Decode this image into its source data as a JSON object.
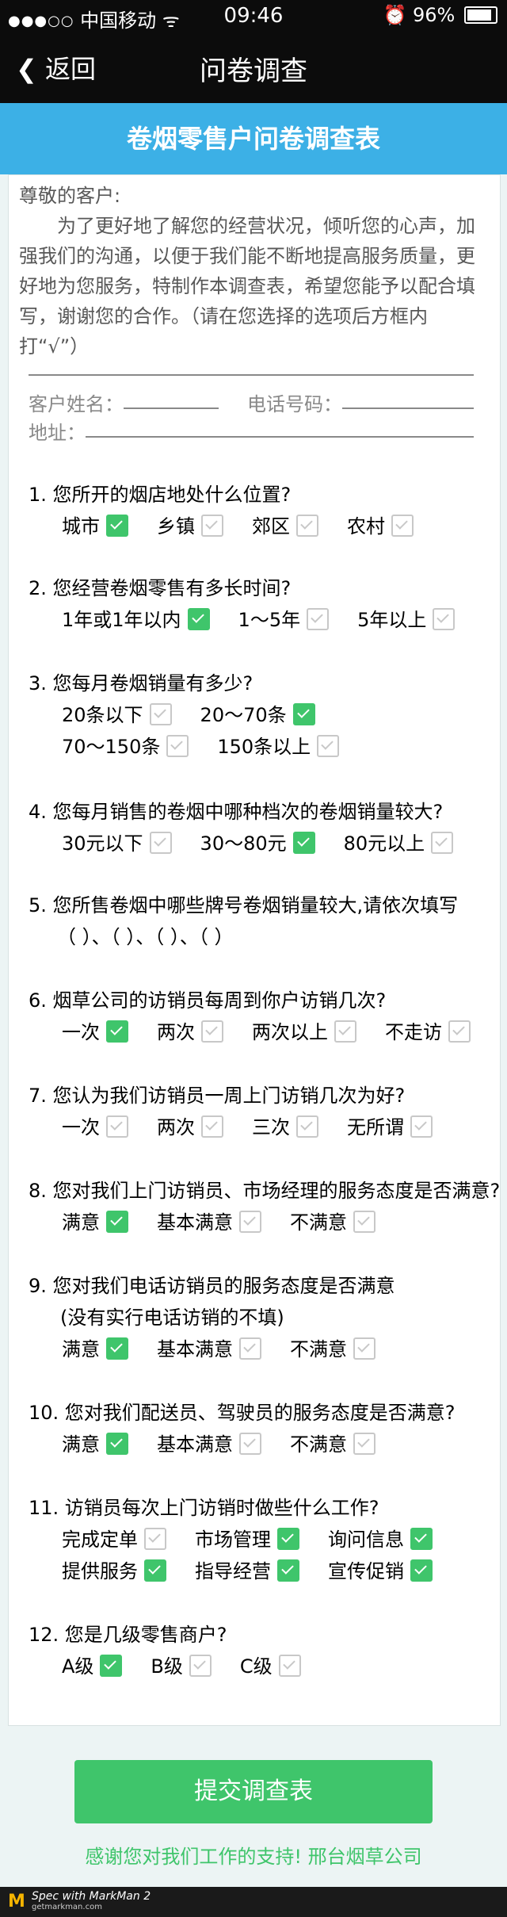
{
  "status": {
    "signal": "●●●○○",
    "carrier": "中国移动",
    "wifi": "ᯤ",
    "time": "09:46",
    "alarm": "⏰",
    "battery": "96%"
  },
  "nav": {
    "back": "返回",
    "title": "问卷调查"
  },
  "banner": {
    "title": "卷烟零售户问卷调查表"
  },
  "intro": {
    "greeting": "尊敬的客户:",
    "body": "为了更好地了解您的经营状况，倾听您的心声，加强我们的沟通，以便于我们能不断地提高服务质量，更好地为您服务，特制作本调查表，希望您能予以配合填写，谢谢您的合作。（请在您选择的选项后方框内打“√”）"
  },
  "fields": {
    "name_label": "客户姓名：",
    "phone_label": "电话号码：",
    "address_label": "地址："
  },
  "questions": [
    {
      "title": "1.  您所开的烟店地处什么位置?",
      "options": [
        [
          "城市",
          true
        ],
        [
          "乡镇",
          false
        ],
        [
          "郊区",
          false
        ],
        [
          "农村",
          false
        ]
      ]
    },
    {
      "title": "2.  您经营卷烟零售有多长时间?",
      "options": [
        [
          "1年或1年以内",
          true
        ],
        [
          "1～5年",
          false
        ],
        [
          "5年以上",
          false
        ]
      ]
    },
    {
      "title": "3.  您每月卷烟销量有多少?",
      "options": [
        [
          "20条以下",
          false
        ],
        [
          "20～70条",
          true
        ]
      ],
      "options2": [
        [
          "70～150条",
          false
        ],
        [
          "150条以上",
          false
        ]
      ]
    },
    {
      "title": "4.  您每月销售的卷烟中哪种档次的卷烟销量较大?",
      "options": [
        [
          "30元以下",
          false
        ],
        [
          "30～80元",
          true
        ],
        [
          "80元以上",
          false
        ]
      ]
    },
    {
      "title": "5.  您所售卷烟中哪些牌号卷烟销量较大,请依次填写",
      "blanks": "（          ）、（          ）、（          ）、（          ）"
    },
    {
      "title": "6.  烟草公司的访销员每周到你户访销几次?",
      "options": [
        [
          "一次",
          true
        ],
        [
          "两次",
          false
        ],
        [
          "两次以上",
          false
        ],
        [
          "不走访",
          false
        ]
      ]
    },
    {
      "title": "7.  您认为我们访销员一周上门访销几次为好?",
      "options": [
        [
          "一次",
          false
        ],
        [
          "两次",
          false
        ],
        [
          "三次",
          false
        ],
        [
          "无所谓",
          false
        ]
      ]
    },
    {
      "title": "8.  您对我们上门访销员、市场经理的服务态度是否满意?",
      "options": [
        [
          "满意",
          true
        ],
        [
          "基本满意",
          false
        ],
        [
          "不满意",
          false
        ]
      ]
    },
    {
      "title": "9.  您对我们电话访销员的服务态度是否满意",
      "subtitle": "(没有实行电话访销的不填)",
      "options": [
        [
          "满意",
          true
        ],
        [
          "基本满意",
          false
        ],
        [
          "不满意",
          false
        ]
      ]
    },
    {
      "title": "10. 您对我们配送员、驾驶员的服务态度是否满意?",
      "options": [
        [
          "满意",
          true
        ],
        [
          "基本满意",
          false
        ],
        [
          "不满意",
          false
        ]
      ]
    },
    {
      "title": "11.  访销员每次上门访销时做些什么工作?",
      "options": [
        [
          "完成定单",
          false
        ],
        [
          "市场管理",
          true
        ],
        [
          "询问信息",
          true
        ]
      ],
      "options2": [
        [
          "提供服务",
          true
        ],
        [
          "指导经营",
          true
        ],
        [
          "宣传促销",
          true
        ]
      ]
    },
    {
      "title": "12.  您是几级零售商户?",
      "options": [
        [
          "A级",
          true
        ],
        [
          "B级",
          false
        ],
        [
          "C级",
          false
        ]
      ]
    }
  ],
  "submit": {
    "label": "提交调查表"
  },
  "thanks": {
    "text": "感谢您对我们工作的支持!   邢台烟草公司"
  },
  "footer": {
    "logo": "M",
    "line1": "Spec with MarkMan 2",
    "line2": "getmarkman.com"
  },
  "colors": {
    "banner": "#3cb0e6",
    "background": "#ecf4f4",
    "accent": "#3fc56b",
    "text_gray": "#585858",
    "line_gray": "#898989"
  }
}
